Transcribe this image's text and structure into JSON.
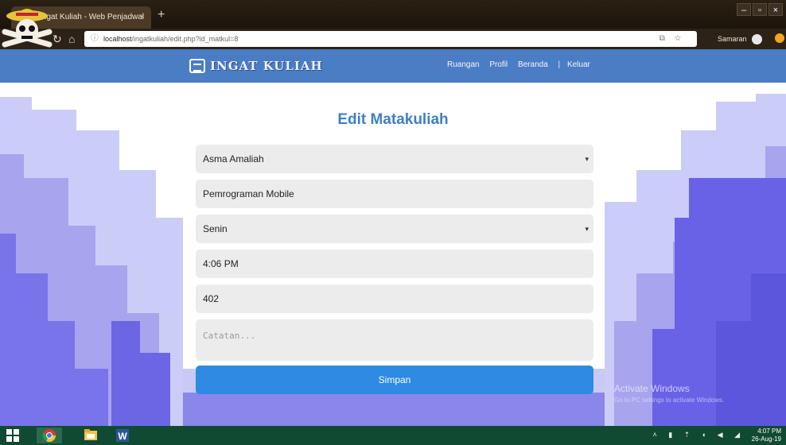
{
  "browser": {
    "tab_title": "Ingat Kuliah - Web Penjadwal",
    "tab_close": "×",
    "new_tab": "+",
    "window_controls": [
      "–",
      "▫",
      "×"
    ],
    "url_host": "localhost",
    "url_path": "/ingatkuliah/edit.php?id_matkul=8",
    "nav_back": "←",
    "nav_reload": "↻",
    "nav_home": "⌂",
    "toolbar_icons": "⧉☆",
    "profile_label": "Samaran"
  },
  "navbar": {
    "brand": "INGAT KULIAH",
    "links": [
      "Ruangan",
      "Profil",
      "Beranda"
    ],
    "separator": "|",
    "logout": "Keluar"
  },
  "form": {
    "title": "Edit Matakuliah",
    "dosen_value": "Asma Amaliah",
    "matkul_value": "Pemrograman Mobile",
    "hari_value": "Senin",
    "jam_value": "4:06 PM",
    "ruangan_value": "402",
    "catatan_placeholder": "Catatan...",
    "select_caret": "▾",
    "submit_label": "Simpan"
  },
  "watermark": {
    "title": "Activate Windows",
    "subtitle": "Go to PC settings to activate Windows."
  },
  "taskbar": {
    "tray": "˄ ▮ ⇡ ◖ ◀ ◢",
    "time": "4:07 PM",
    "date": "26-Aug-19"
  },
  "colors": {
    "navbar": "#4a7dc4",
    "title": "#3d7fc9",
    "button": "#2e8ae2",
    "field": "#ececec",
    "taskbar": "#104a32"
  }
}
